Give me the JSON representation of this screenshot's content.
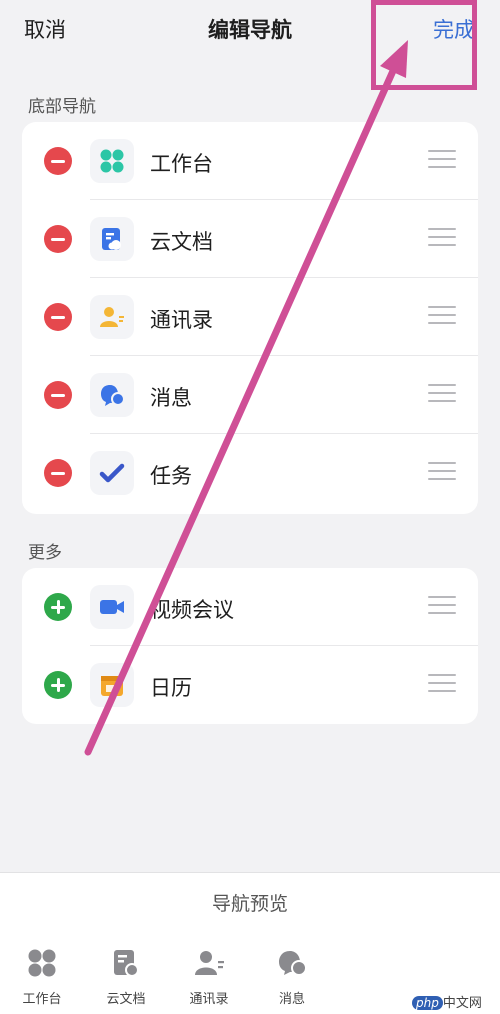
{
  "header": {
    "cancel_label": "取消",
    "title": "编辑导航",
    "done_label": "完成"
  },
  "bottom_nav_section": {
    "label": "底部导航",
    "items": [
      {
        "label": "工作台",
        "icon": "grid-four-icon",
        "action": "remove"
      },
      {
        "label": "云文档",
        "icon": "cloud-doc-icon",
        "action": "remove"
      },
      {
        "label": "通讯录",
        "icon": "contacts-icon",
        "action": "remove"
      },
      {
        "label": "消息",
        "icon": "message-bubble-icon",
        "action": "remove"
      },
      {
        "label": "任务",
        "icon": "task-check-icon",
        "action": "remove"
      }
    ]
  },
  "more_section": {
    "label": "更多",
    "items": [
      {
        "label": "视频会议",
        "icon": "video-camera-icon",
        "action": "add"
      },
      {
        "label": "日历",
        "icon": "calendar-icon",
        "action": "add"
      }
    ]
  },
  "preview": {
    "title": "导航预览",
    "tabs": [
      {
        "label": "工作台",
        "icon": "grid-four-icon"
      },
      {
        "label": "云文档",
        "icon": "cloud-doc-icon"
      },
      {
        "label": "通讯录",
        "icon": "contacts-icon"
      },
      {
        "label": "消息",
        "icon": "message-bubble-icon"
      }
    ]
  },
  "watermark": {
    "badge": "php",
    "text": "中文网"
  },
  "colors": {
    "accent": "#3a6fd4",
    "remove": "#e5484d",
    "add": "#2ea84a",
    "annotation": "#cf4f96"
  }
}
